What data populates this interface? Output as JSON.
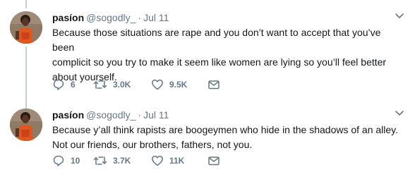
{
  "tweets": [
    {
      "display_name": "pasíon",
      "handle": "@sogodly_",
      "separator": "·",
      "time": "Jul 11",
      "lines": [
        "Because those situations are rape and you don’t want to accept that you’ve been",
        "complicit so you try to make it seem like women are lying so you’ll feel better",
        "about yourself."
      ],
      "replies": "6",
      "retweets": "3.0K",
      "likes": "9.5K"
    },
    {
      "display_name": "pasíon",
      "handle": "@sogodly_",
      "separator": "·",
      "time": "Jul 11",
      "lines": [
        "Because y’all think rapists are boogeymen who hide in the shadows of an alley.",
        "Not our friends, our brothers, fathers, not you."
      ],
      "replies": "10",
      "retweets": "3.7K",
      "likes": "11K"
    }
  ],
  "icons": {
    "reply": "reply-icon",
    "retweet": "retweet-icon",
    "like": "heart-icon",
    "dm": "envelope-icon",
    "more": "chevron-down-icon"
  },
  "colors": {
    "text": "#14171a",
    "secondary": "#657786",
    "thread_line": "#c4cfd6"
  }
}
